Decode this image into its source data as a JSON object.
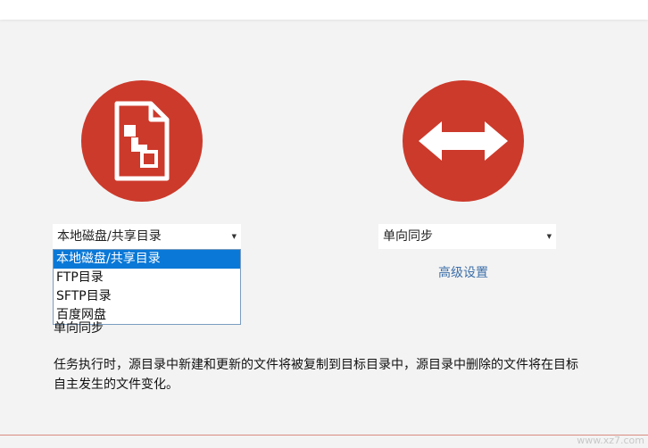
{
  "source": {
    "icon": "file-tree-icon",
    "selected": "本地磁盘/共享目录",
    "options": [
      "本地磁盘/共享目录",
      "FTP目录",
      "SFTP目录",
      "百度网盘"
    ]
  },
  "mode": {
    "icon": "two-way-arrow-icon",
    "selected": "单向同步",
    "advanced_link": "高级设置"
  },
  "description": {
    "title": "单向同步",
    "line1": "任务执行时，源目录中新建和更新的文件将被复制到目标目录中，源目录中删除的文件将在目标",
    "line2": "自主发生的文件变化。"
  },
  "watermark": "www.xz7.com",
  "colors": {
    "accent_red": "#cc3a2b",
    "selection_blue": "#0a78d7",
    "link_blue": "#3e6fa8"
  }
}
